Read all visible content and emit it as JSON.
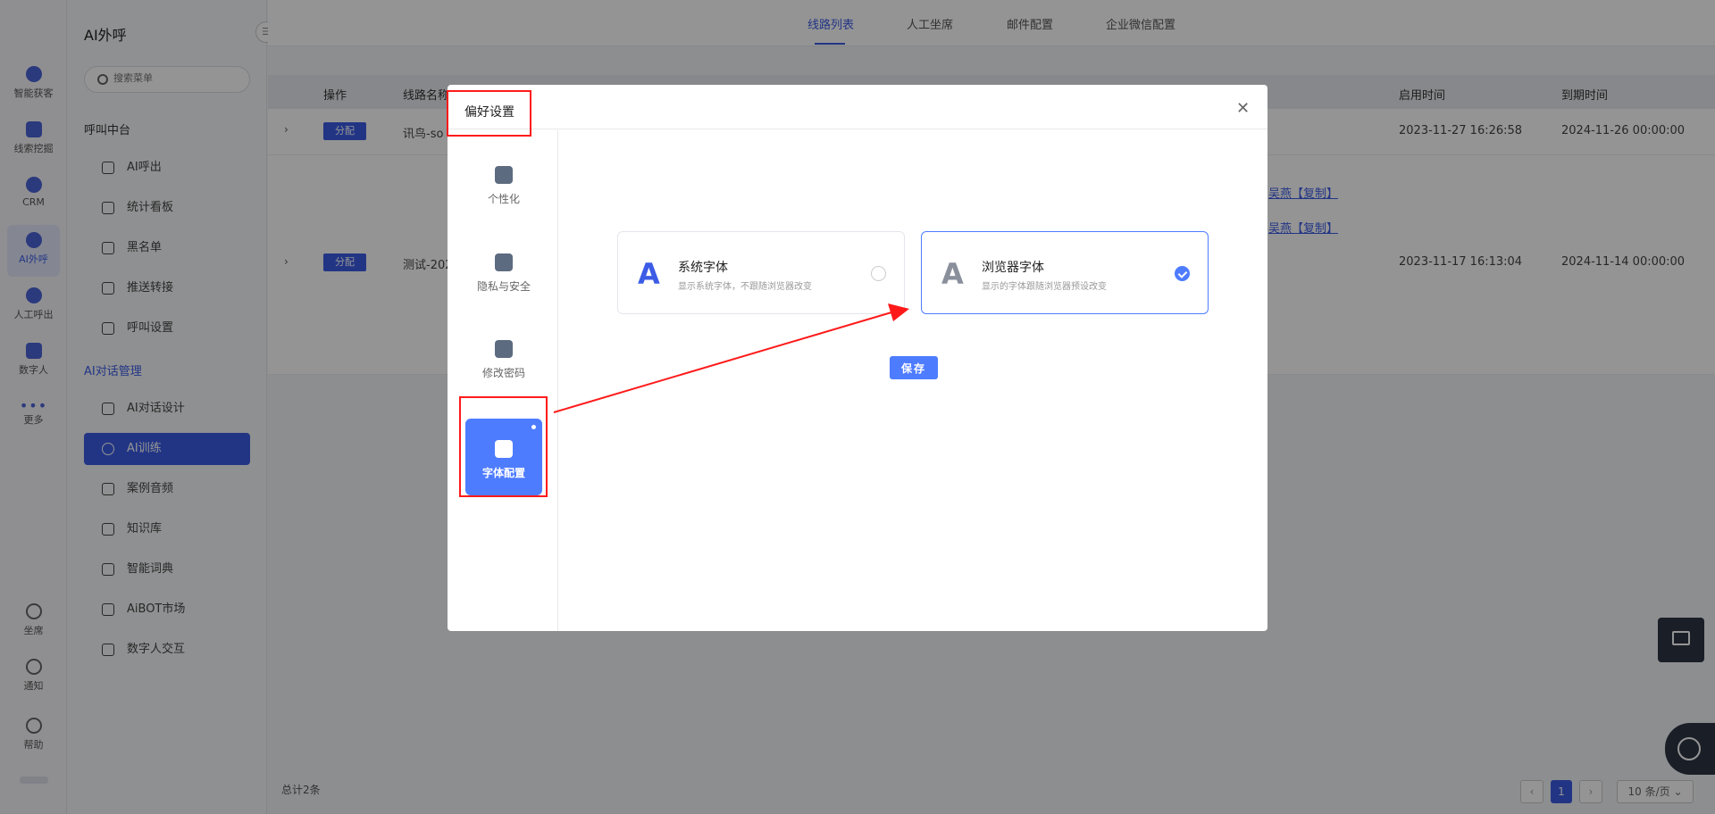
{
  "rail": {
    "items": [
      {
        "label": "智能获客",
        "icon": "target-icon"
      },
      {
        "label": "线索挖掘",
        "icon": "document-icon"
      },
      {
        "label": "CRM",
        "icon": "people-icon"
      },
      {
        "label": "AI外呼",
        "icon": "ai-call-icon"
      },
      {
        "label": "人工呼出",
        "icon": "headset-icon"
      },
      {
        "label": "数字人",
        "icon": "robot-icon"
      },
      {
        "label": "更多",
        "icon": "more-icon"
      }
    ],
    "bottom": [
      {
        "label": "坐席",
        "icon": "headphones-icon"
      },
      {
        "label": "通知",
        "icon": "bell-icon"
      },
      {
        "label": "帮助",
        "icon": "help-icon"
      }
    ]
  },
  "menu": {
    "title": "AI外呼",
    "search_placeholder": "搜索菜单",
    "group1": "呼叫中台",
    "group1_items": [
      "AI呼出",
      "统计看板",
      "黑名单",
      "推送转接",
      "呼叫设置"
    ],
    "group2": "AI对话管理",
    "group2_items": [
      "AI对话设计",
      "AI训练",
      "案例音频",
      "知识库",
      "智能词典",
      "AiBOT市场",
      "数字人交互"
    ]
  },
  "tabs": [
    "线路列表",
    "人工坐席",
    "邮件配置",
    "企业微信配置"
  ],
  "table": {
    "columns": [
      "操作",
      "线路名称",
      "启用时间",
      "到期时间"
    ],
    "rows": [
      {
        "action": "分配",
        "name": "讯鸟-so",
        "start": "2023-11-27 16:26:58",
        "end": "2024-11-26 00:00:00"
      },
      {
        "action": "分配",
        "name": "测试-202",
        "start": "2023-11-17 16:13:04",
        "end": "2024-11-14 00:00:00",
        "links": [
          "吴燕【复制】",
          "吴燕【复制】"
        ]
      }
    ],
    "total": "总计2条",
    "page": "1",
    "page_size": "10 条/页"
  },
  "modal": {
    "title": "偏好设置",
    "nav": [
      {
        "label": "个性化",
        "icon": "shirt-icon"
      },
      {
        "label": "隐私与安全",
        "icon": "shield-user-icon"
      },
      {
        "label": "修改密码",
        "icon": "lock-icon"
      },
      {
        "label": "字体配置",
        "icon": "text-font-icon"
      }
    ],
    "cards": [
      {
        "glyph": "A",
        "title": "系统字体",
        "desc": "显示系统字体，不跟随浏览器改变"
      },
      {
        "glyph": "A",
        "title": "浏览器字体",
        "desc": "显示的字体跟随浏览器预设改变"
      }
    ],
    "save": "保存"
  },
  "colors": {
    "accent": "#3c5ce6",
    "modal_accent": "#4e7cff",
    "annotation": "#ff1a1a"
  }
}
